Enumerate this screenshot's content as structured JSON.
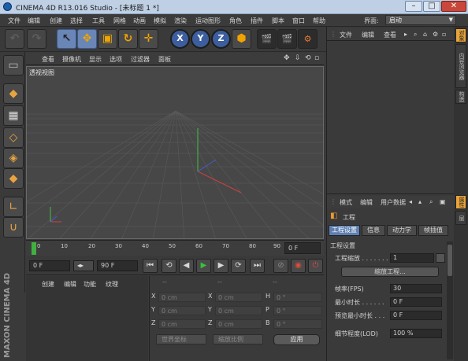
{
  "window": {
    "title": "CINEMA 4D R13.016 Studio - [未标题 1 *]"
  },
  "menu": {
    "items": [
      "文件",
      "编辑",
      "创建",
      "选择",
      "工具",
      "网格",
      "动画",
      "模拟",
      "渲染",
      "运动图形",
      "角色",
      "插件",
      "脚本",
      "窗口",
      "帮助"
    ],
    "interface_label": "界面:",
    "interface_value": "启动"
  },
  "toolbar": {
    "axis_x": "X",
    "axis_y": "Y",
    "axis_z": "Z"
  },
  "viewport": {
    "menu": [
      "查看",
      "摄像机",
      "显示",
      "选项",
      "过滤器",
      "面板"
    ],
    "label": "透视视图"
  },
  "timeline": {
    "ticks": [
      "0",
      "10",
      "20",
      "30",
      "40",
      "50",
      "60",
      "70",
      "80",
      "90"
    ],
    "current": "0 F"
  },
  "transport": {
    "start": "0 F",
    "end": "90 F"
  },
  "material": {
    "menu": [
      "创建",
      "编辑",
      "功能",
      "纹理"
    ],
    "brand": "MAXON CINEMA 4D"
  },
  "coords": {
    "headers": [
      "--",
      "--",
      "--"
    ],
    "rows": [
      {
        "l1": "X",
        "v1": "0 cm",
        "l2": "X",
        "v2": "0 cm",
        "l3": "H",
        "v3": "0 °"
      },
      {
        "l1": "Y",
        "v1": "0 cm",
        "l2": "Y",
        "v2": "0 cm",
        "l3": "P",
        "v3": "0 °"
      },
      {
        "l1": "Z",
        "v1": "0 cm",
        "l2": "Z",
        "v2": "0 cm",
        "l3": "B",
        "v3": "0 °"
      }
    ],
    "space": "世界坐标",
    "scale": "缩放比例",
    "apply": "应用"
  },
  "objects": {
    "menu": [
      "文件",
      "编辑",
      "查看"
    ]
  },
  "attributes": {
    "menu": [
      "模式",
      "编辑",
      "用户数据"
    ],
    "title": "工程",
    "tabs": [
      "工程设置",
      "信息",
      "动力学",
      "帧插值"
    ],
    "section": "工程设置",
    "rows": [
      {
        "label": "工程缩放 . . . . . . .",
        "value": "1"
      },
      {
        "label": "帧率(FPS)",
        "value": "30"
      },
      {
        "label": "最小时长 . . . . . .",
        "value": "0 F"
      },
      {
        "label": "预览最小时长 . . .",
        "value": "0 F"
      },
      {
        "label": "细节程度(LOD)",
        "value": "100 %"
      }
    ],
    "scale_button": "缩放工程..."
  },
  "side_tabs": [
    "对象",
    "内容浏览器",
    "构造"
  ],
  "side_tabs2": [
    "属性",
    "层"
  ],
  "colors": {
    "accent": "#6a86b6",
    "play": "#38c13a",
    "record": "#e14a3a",
    "grid_x": "#d04040",
    "grid_y": "#40c040",
    "grid_z": "#4060d0"
  }
}
